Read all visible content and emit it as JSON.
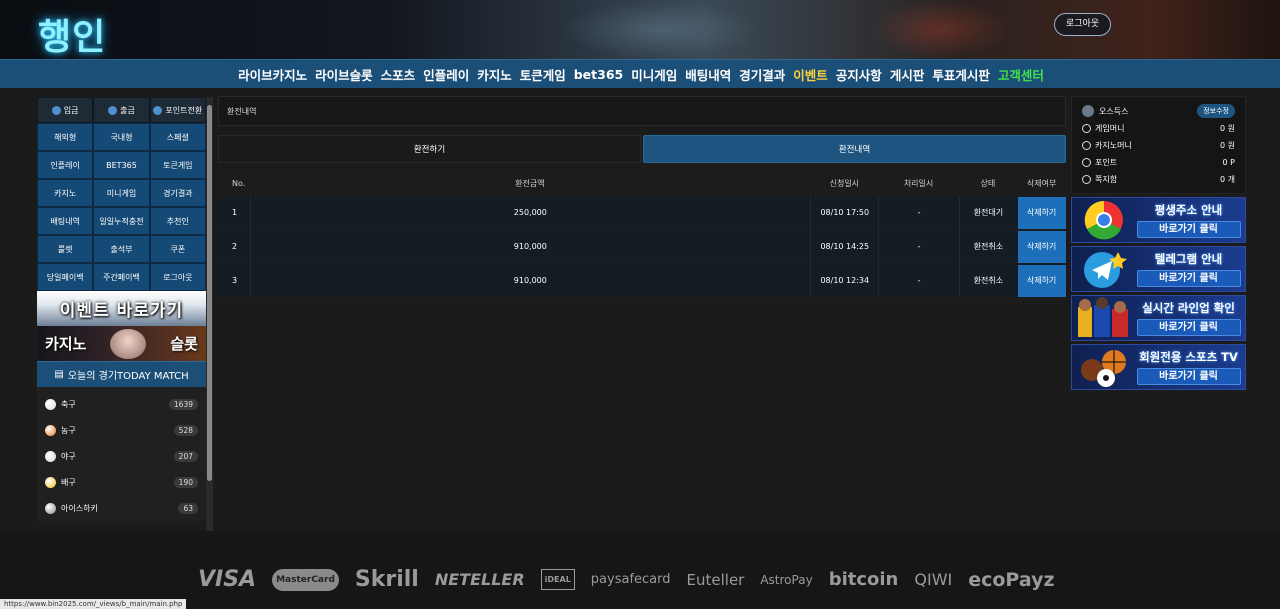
{
  "header": {
    "logo": "행인",
    "logout": "로그아웃"
  },
  "nav": {
    "items": [
      {
        "label": "라이브카지노",
        "color": "white"
      },
      {
        "label": "라이브슬롯",
        "color": "white"
      },
      {
        "label": "스포츠",
        "color": "white"
      },
      {
        "label": "인플레이",
        "color": "white"
      },
      {
        "label": "카지노",
        "color": "white"
      },
      {
        "label": "토큰게임",
        "color": "white"
      },
      {
        "label": "bet365",
        "color": "white"
      },
      {
        "label": "미니게임",
        "color": "white"
      },
      {
        "label": "배팅내역",
        "color": "white"
      },
      {
        "label": "경기결과",
        "color": "white"
      },
      {
        "label": "이벤트",
        "color": "yellow"
      },
      {
        "label": "공지사항",
        "color": "white"
      },
      {
        "label": "게시판",
        "color": "white"
      },
      {
        "label": "투표게시판",
        "color": "white"
      },
      {
        "label": "고객센터",
        "color": "green"
      }
    ]
  },
  "left": {
    "top_buttons": [
      "입금",
      "출금",
      "포인트전환"
    ],
    "grid": [
      "해외형",
      "국내형",
      "스페셜",
      "인플레이",
      "BET365",
      "토큰게임",
      "카지노",
      "미니게임",
      "경기결과",
      "배팅내역",
      "일일누적충전",
      "추천인",
      "룰렛",
      "출석부",
      "쿠폰",
      "당일페이백",
      "주간페이백",
      "로그아웃"
    ],
    "banner_event": "이벤트 바로가기",
    "banner_casino_left": "카지노",
    "banner_casino_right": "슬롯",
    "today_match": "오늘의 경기TODAY MATCH",
    "sports": [
      {
        "name": "축구",
        "count": "1639",
        "color": "#dddddd"
      },
      {
        "name": "농구",
        "count": "528",
        "color": "#e07a20"
      },
      {
        "name": "야구",
        "count": "207",
        "color": "#cfcfcf"
      },
      {
        "name": "배구",
        "count": "190",
        "color": "#f0c020"
      },
      {
        "name": "아이스하키",
        "count": "63",
        "color": "#8a8a8a"
      }
    ]
  },
  "main": {
    "breadcrumb": "환전내역",
    "tabs": [
      "환전하기",
      "환전내역"
    ],
    "columns": [
      "No.",
      "환전금액",
      "신청일시",
      "처리일시",
      "상태",
      "삭제여부"
    ],
    "rows": [
      {
        "no": "1",
        "amount": "250,000",
        "requested": "08/10 17:50",
        "processed": "-",
        "status": "환전대기",
        "action": "삭제하기"
      },
      {
        "no": "2",
        "amount": "910,000",
        "requested": "08/10 14:25",
        "processed": "-",
        "status": "환전취소",
        "action": "삭제하기"
      },
      {
        "no": "3",
        "amount": "910,000",
        "requested": "08/10 12:34",
        "processed": "-",
        "status": "환전취소",
        "action": "삭제하기"
      }
    ]
  },
  "right": {
    "username": "오스득스",
    "edit": "정보수정",
    "lines": [
      {
        "label": "게임머니",
        "value": "0 원"
      },
      {
        "label": "카지노머니",
        "value": "0 원"
      },
      {
        "label": "포인트",
        "value": "0 P"
      },
      {
        "label": "쪽지함",
        "value": "0 개"
      }
    ],
    "banners": [
      {
        "title": "평생주소 안내",
        "button": "바로가기 클릭",
        "icon": "chrome-icon"
      },
      {
        "title": "텔레그램 안내",
        "button": "바로가기 클릭",
        "icon": "telegram-icon"
      },
      {
        "title": "실시간 라인업 확인",
        "button": "바로가기 클릭",
        "icon": "players-icon"
      },
      {
        "title": "회원전용 스포츠 TV",
        "button": "바로가기 클릭",
        "icon": "balls-icon"
      }
    ]
  },
  "footer": {
    "payments": [
      "VISA",
      "MasterCard",
      "Skrill",
      "NETELLER",
      "iDEAL",
      "paysafecard",
      "Euteller",
      "AstroPay",
      "bitcoin",
      "QIWI",
      "ecoPayz"
    ]
  },
  "status_url": "https://www.bin2025.com/_views/b_main/main.php"
}
